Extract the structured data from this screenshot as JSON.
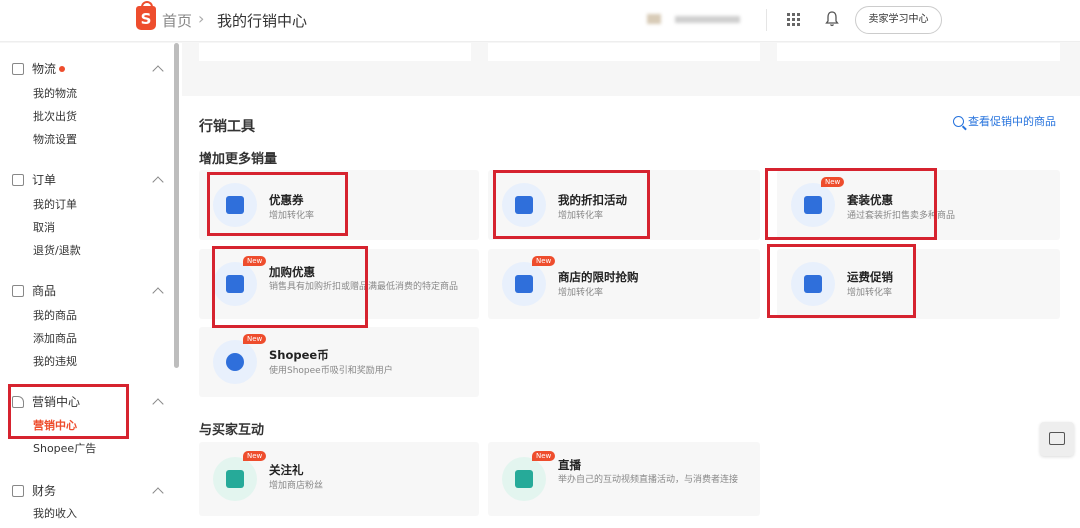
{
  "topbar": {
    "logo_text": "S",
    "breadcrumb_home": "首页",
    "breadcrumb_sep": "›",
    "breadcrumb_current": "我的行销中心",
    "learning_button": "卖家学习中心"
  },
  "sidebar": {
    "groups": [
      {
        "title": "物流",
        "items": [
          "我的物流",
          "批次出货",
          "物流设置"
        ]
      },
      {
        "title": "订单",
        "items": [
          "我的订单",
          "取消",
          "退货/退款"
        ]
      },
      {
        "title": "商品",
        "items": [
          "我的商品",
          "添加商品",
          "我的违规"
        ]
      },
      {
        "title": "营销中心",
        "items": [
          "营销中心",
          "Shopee广告"
        ]
      },
      {
        "title": "财务",
        "items": [
          "我的收入"
        ]
      }
    ]
  },
  "main": {
    "section_title": "行销工具",
    "view_link": "查看促销中的商品",
    "sub_title_1": "增加更多销量",
    "sub_title_2": "与买家互动",
    "badge_text": "New",
    "tools": [
      {
        "title": "优惠券",
        "desc": "增加转化率"
      },
      {
        "title": "我的折扣活动",
        "desc": "增加转化率"
      },
      {
        "title": "套装优惠",
        "desc": "通过套装折扣售卖多种商品"
      },
      {
        "title": "加购优惠",
        "desc": "销售具有加购折扣或赠品满最低消费的特定商品"
      },
      {
        "title": "商店的限时抢购",
        "desc": "增加转化率"
      },
      {
        "title": "运费促销",
        "desc": "增加转化率"
      },
      {
        "title": "Shopee币",
        "desc": "使用Shopee币吸引和奖励用户"
      }
    ],
    "engage": [
      {
        "title": "关注礼",
        "desc": "增加商店粉丝"
      },
      {
        "title": "直播",
        "desc": "举办自己的互动视频直播活动，与消费者连接"
      }
    ]
  },
  "colors": {
    "brand": "#ee4d2d",
    "link": "#2673dd",
    "highlight": "#d6232f",
    "icon_blue": "#2f6fdb",
    "icon_green": "#26aa99"
  }
}
